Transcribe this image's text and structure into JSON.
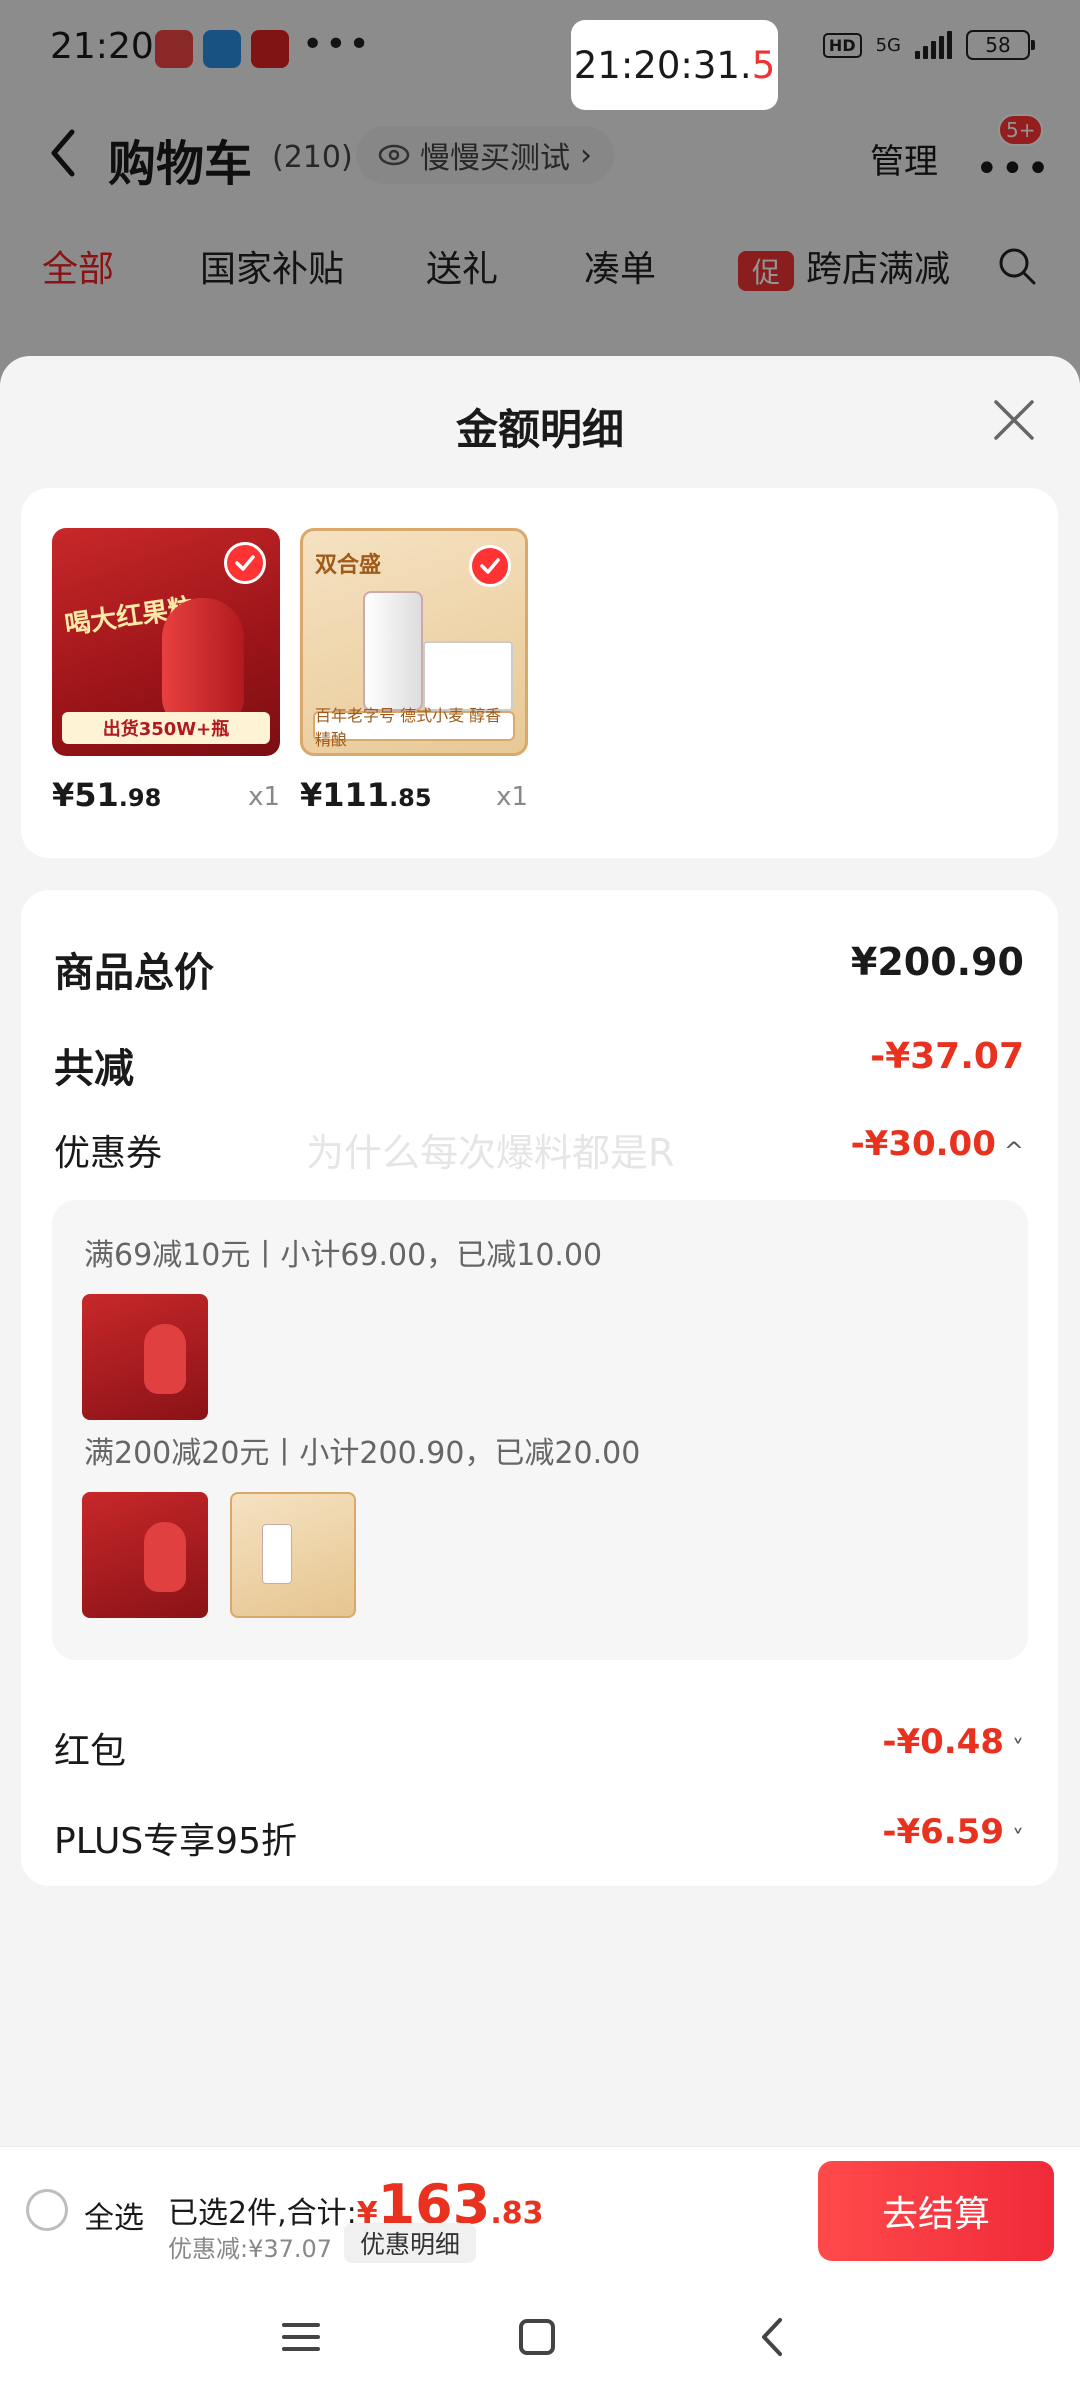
{
  "status_bar": {
    "time": "21:20",
    "apps": [
      {
        "icon": "app-badge-red-icon",
        "label": "送外卖"
      },
      {
        "icon": "app-badge-blue-icon",
        "label": "TP"
      },
      {
        "icon": "bank-icon",
        "label": "工"
      }
    ],
    "more": "•••",
    "clock_main": "21:20:31.",
    "clock_tenth": "5",
    "network": "5G",
    "hd": "HD",
    "battery": "58"
  },
  "nav": {
    "title": "购物车",
    "count": "(210)",
    "pill_label": "慢慢买测试",
    "pill_chevron": "›",
    "manage": "管理",
    "more": "•••",
    "badge": "5+"
  },
  "tabs": [
    {
      "label": "全部",
      "active": true
    },
    {
      "label": "国家补贴",
      "active": false
    },
    {
      "label": "送礼",
      "active": false
    },
    {
      "label": "凑单",
      "active": false
    },
    {
      "label": "跨店满减",
      "active": false,
      "promo_icon": "促"
    }
  ],
  "sheet": {
    "title": "金额明细",
    "products": [
      {
        "price_int": "¥51",
        "price_dec": ".98",
        "qty": "x1",
        "img_text": "喝大红果粒",
        "img_banner": "出货350W+瓶"
      },
      {
        "price_int": "¥111",
        "price_dec": ".85",
        "qty": "x1",
        "img_text": "双合盛",
        "img_banner": "百年老字号 德式小麦 醇香精酿"
      }
    ],
    "rows": {
      "total_label": "商品总价",
      "total_value": "¥200.90",
      "discount_label": "共减",
      "discount_value": "-¥37.07",
      "coupon_label": "优惠券",
      "coupon_value": "-¥30.00",
      "coupon_chevron": "^",
      "redpacket_label": "红包",
      "redpacket_value": "-¥0.48",
      "redpacket_chevron": "˅",
      "plus_label": "PLUS专享95折",
      "plus_value": "-¥6.59",
      "plus_chevron": "˅"
    },
    "watermark": "为什么每次爆料都是R",
    "coupon_details": [
      {
        "text": "满69减10元丨小计69.00，已减10.00"
      },
      {
        "text": "满200减20元丨小计200.90，已减20.00"
      }
    ]
  },
  "bottom_bar": {
    "select_all": "全选",
    "summary_prefix": "已选2件,合计:",
    "total_yen": "¥",
    "total_int": "163",
    "total_dec": ".83",
    "discount": "优惠减:¥37.07",
    "detail_chip": "优惠明细",
    "checkout": "去结算"
  },
  "colors": {
    "accent_red": "#e8321f",
    "checkout_red": "#f02a3a",
    "sheet_bg": "#f4f4f4"
  }
}
